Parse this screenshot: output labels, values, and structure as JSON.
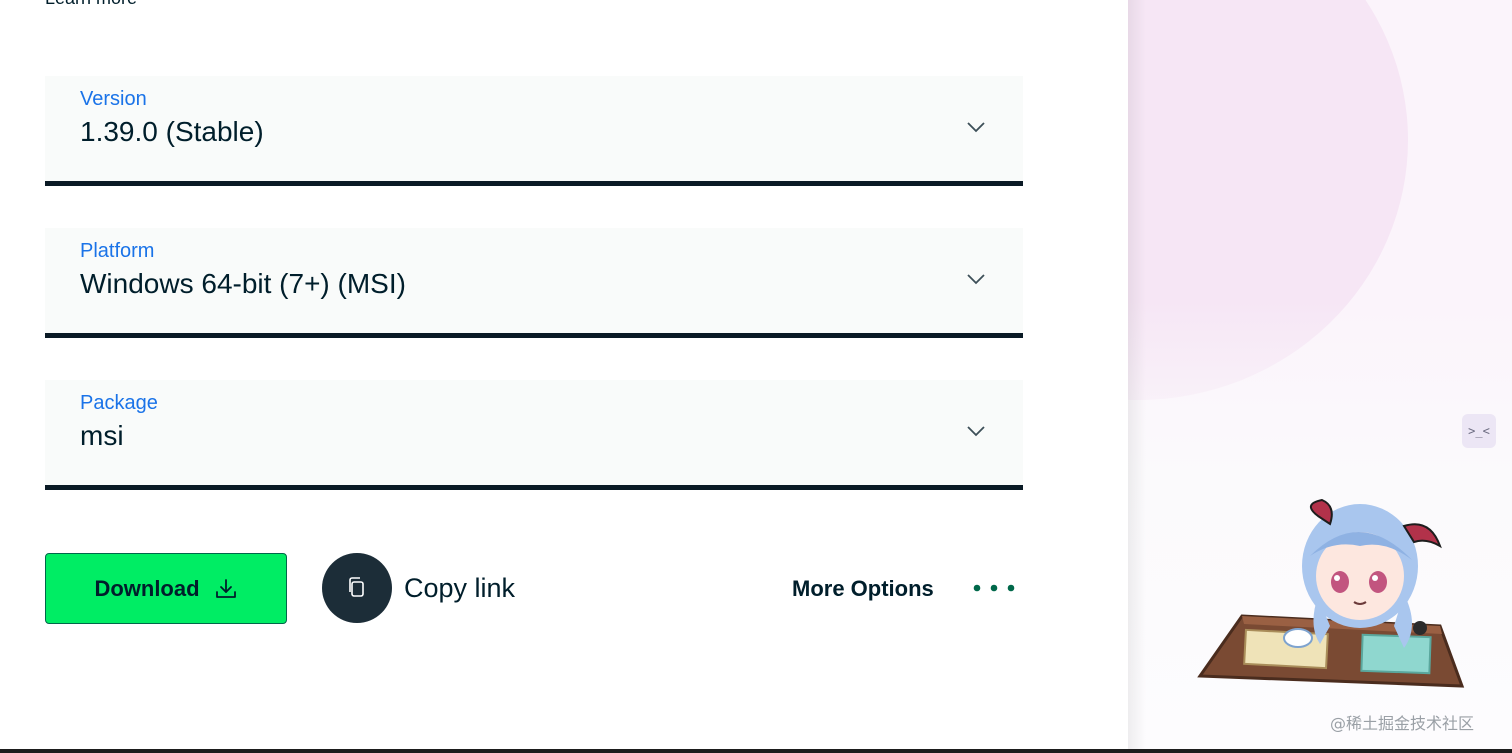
{
  "header": {
    "learn_more": "Learn more"
  },
  "selects": [
    {
      "label": "Version",
      "value": "1.39.0 (Stable)"
    },
    {
      "label": "Platform",
      "value": "Windows 64-bit (7+) (MSI)"
    },
    {
      "label": "Package",
      "value": "msi"
    }
  ],
  "actions": {
    "download_label": "Download",
    "copy_link_label": "Copy link",
    "more_options_label": "More Options"
  },
  "float_tool": {
    "glyph": ">_<"
  },
  "watermark": "@稀土掘金技术社区",
  "colors": {
    "accent_green": "#00ed64",
    "label_blue": "#1a73e8",
    "dark": "#001e2b"
  },
  "icons": {
    "chevron": "chevron-down-icon",
    "download": "download-icon",
    "copy": "copy-icon",
    "more": "more-dots-icon"
  }
}
